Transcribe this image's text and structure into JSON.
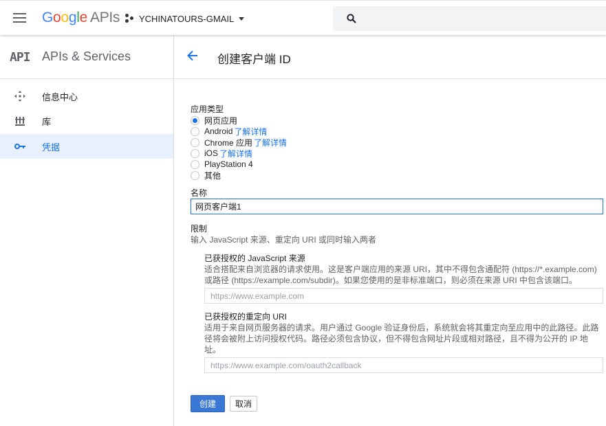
{
  "header": {
    "logo_google": [
      "G",
      "o",
      "o",
      "g",
      "l",
      "e"
    ],
    "logo_apis": "APIs",
    "project_name": "YCHINATOURS-GMAIL",
    "search_placeholder": ""
  },
  "sidebar": {
    "badge": "API",
    "title": "APIs & Services",
    "items": [
      {
        "label": "信息中心",
        "icon": "dashboard-icon",
        "active": false
      },
      {
        "label": "库",
        "icon": "library-icon",
        "active": false
      },
      {
        "label": "凭据",
        "icon": "key-icon",
        "active": true
      }
    ]
  },
  "page": {
    "title": "创建客户端 ID"
  },
  "form": {
    "app_type_label": "应用类型",
    "app_types": [
      {
        "label": "网页应用",
        "link": "",
        "checked": true
      },
      {
        "label": "Android",
        "link": "了解详情",
        "checked": false
      },
      {
        "label": "Chrome 应用",
        "link": "了解详情",
        "checked": false
      },
      {
        "label": "iOS",
        "link": "了解详情",
        "checked": false
      },
      {
        "label": "PlayStation 4",
        "link": "",
        "checked": false
      },
      {
        "label": "其他",
        "link": "",
        "checked": false
      }
    ],
    "name_label": "名称",
    "name_value": "网页客户端1",
    "restrictions_label": "限制",
    "restrictions_desc": "输入 JavaScript 来源、重定向 URI 或同时输入两者",
    "js_origins": {
      "title": "已获授权的 JavaScript 来源",
      "desc": "适合搭配来自浏览器的请求使用。这是客户端应用的来源 URI，其中不得包含通配符 (https://*.example.com) 或路径 (https://example.com/subdir)。如果您使用的是非标准端口，则必须在来源 URI 中包含该端口。",
      "placeholder": "https://www.example.com"
    },
    "redirect_uris": {
      "title": "已获授权的重定向 URI",
      "desc": "适用于来自网页服务器的请求。用户通过 Google 验证身份后，系统就会将其重定向至应用中的此路径。此路径将会被附上访问授权代码。路径必须包含协议，但不得包含网址片段或相对路径，且不得为公开的 IP 地址。",
      "placeholder": "https://www.example.com/oauth2callback"
    },
    "create_label": "创建",
    "cancel_label": "取消"
  }
}
